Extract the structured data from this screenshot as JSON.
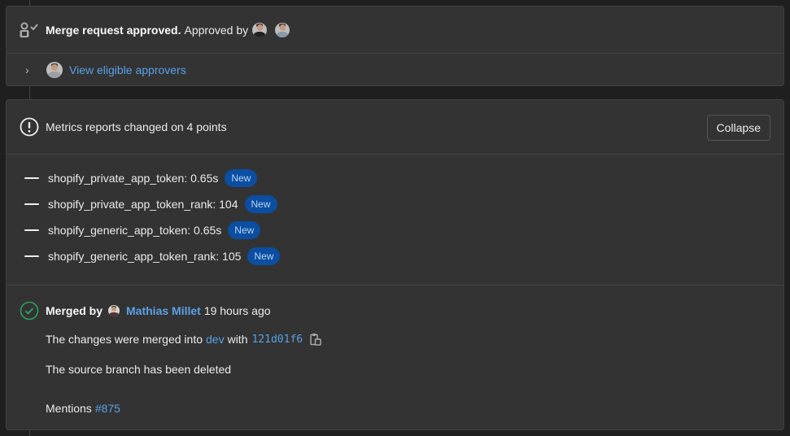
{
  "approval": {
    "title": "Merge request approved.",
    "approved_by_label": "Approved by",
    "approvers": [
      "approver-1",
      "approver-2"
    ],
    "eligible_link": "View eligible approvers",
    "icons": {
      "approval": "user-check-icon",
      "expand": "chevron-right-icon"
    }
  },
  "metrics": {
    "title": "Metrics reports changed on 4 points",
    "collapse_label": "Collapse",
    "icon": "exclamation-circle-icon",
    "items": [
      {
        "text": "shopify_private_app_token: 0.65s",
        "badge": "New"
      },
      {
        "text": "shopify_private_app_token_rank: 104",
        "badge": "New"
      },
      {
        "text": "shopify_generic_app_token: 0.65s",
        "badge": "New"
      },
      {
        "text": "shopify_generic_app_token_rank: 105",
        "badge": "New"
      }
    ],
    "badge_color": "#0b4ea2"
  },
  "merged": {
    "label": "Merged by",
    "user": "Mathias Millet",
    "time": "19 hours ago",
    "changes_prefix": "The changes were merged into",
    "branch": "dev",
    "with_label": "with",
    "commit": "121d01f6",
    "source_branch_text": "The source branch has been deleted",
    "mentions_label": "Mentions",
    "mention_ref": "#875",
    "icons": {
      "status": "check-circle-icon",
      "copy": "clipboard-icon"
    },
    "status_color": "#2da160"
  },
  "colors": {
    "link": "#5aa1e8",
    "panel": "#333333",
    "background": "#1f1f1f"
  }
}
